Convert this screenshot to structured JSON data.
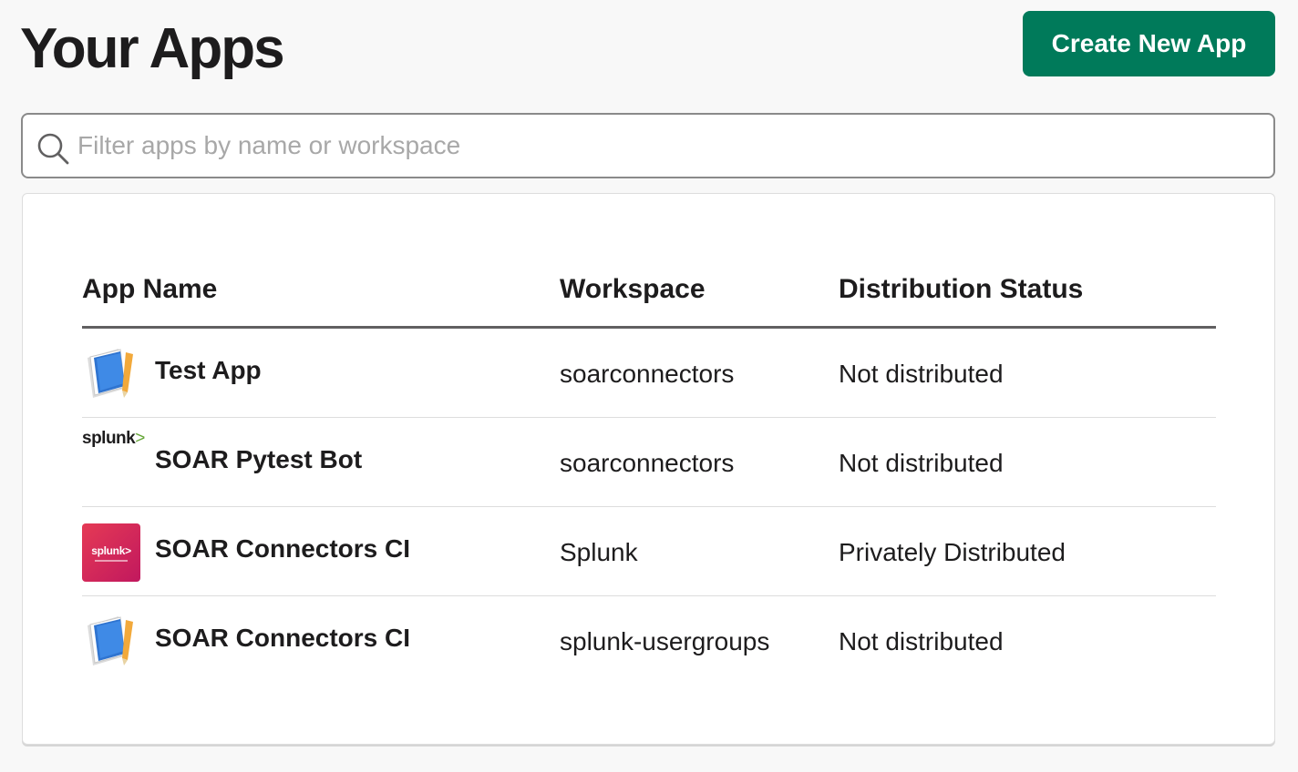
{
  "header": {
    "title": "Your Apps",
    "create_label": "Create New App"
  },
  "search": {
    "placeholder": "Filter apps by name or workspace",
    "value": ""
  },
  "table": {
    "columns": {
      "name": "App Name",
      "workspace": "Workspace",
      "status": "Distribution Status"
    },
    "rows": [
      {
        "name": "Test App",
        "workspace": "soarconnectors",
        "status": "Not distributed",
        "icon": "notebook-pencil-icon"
      },
      {
        "name": "SOAR Pytest Bot",
        "workspace": "soarconnectors",
        "status": "Not distributed",
        "icon": "splunk-logo-icon",
        "logo_text": "splunk",
        "logo_chev": ">"
      },
      {
        "name": "SOAR Connectors CI",
        "workspace": "Splunk",
        "status": "Privately Distributed",
        "icon": "splunk-badge-icon",
        "logo_text": "splunk>"
      },
      {
        "name": "SOAR Connectors CI",
        "workspace": "splunk-usergroups",
        "status": "Not distributed",
        "icon": "notebook-pencil-icon"
      }
    ]
  },
  "colors": {
    "accent": "#007a5a",
    "splunk_pink": "#e53a55",
    "splunk_green": "#65a637"
  }
}
